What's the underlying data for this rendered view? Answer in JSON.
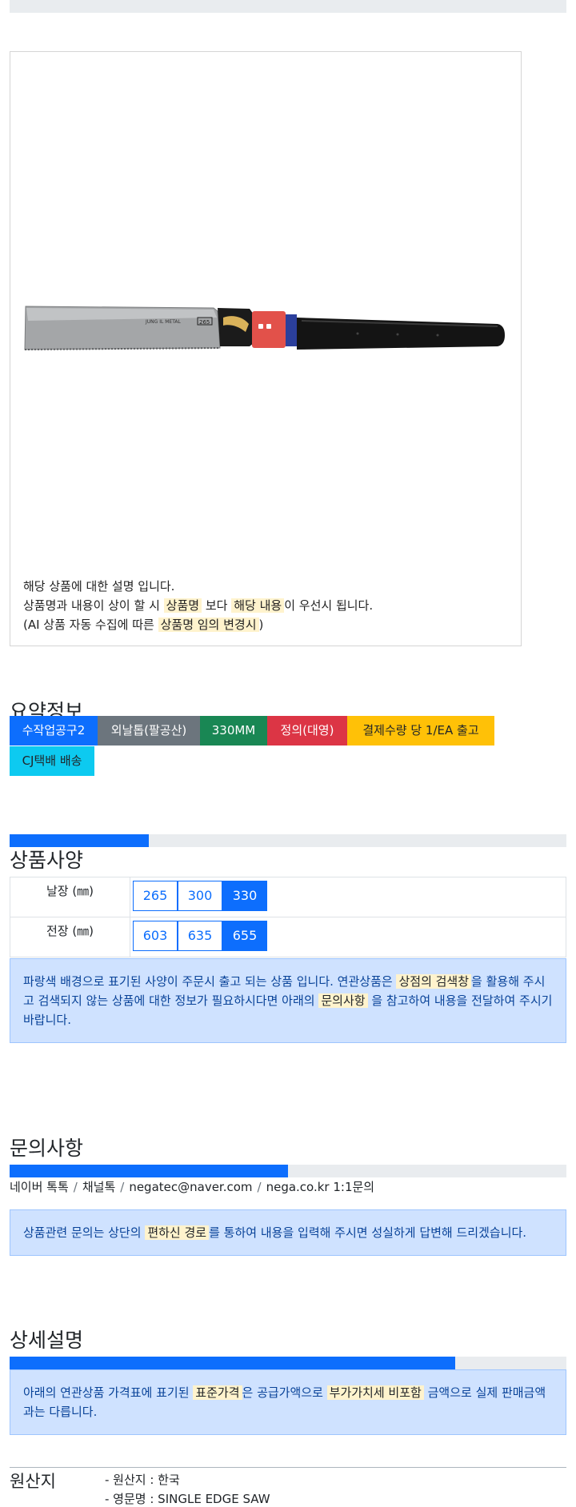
{
  "product": {
    "image_alt": "single edge saw",
    "note_lines": {
      "line1": "해당 상품에 대한 설명 입니다.",
      "line2_a": "상품명과 내용이 상이 할 시",
      "line2_hl1": "상품명",
      "line2_b": "보다",
      "line2_hl2": "해당 내용",
      "line2_c": "이 우선시 됩니다.",
      "line3_a": "(AI 상품 자동 수집에 따른",
      "line3_hl": "상품명 임의 변경시",
      "line3_b": ")"
    }
  },
  "summary": {
    "title": "요약정보",
    "badges": [
      "수작업공구2",
      "외날톱(팔공산)",
      "330MM",
      "정의(대영)",
      "결제수량 당 1/EA 출고",
      "CJ택배 배송"
    ]
  },
  "specs": {
    "title": "상품사양",
    "progress_percent": 25,
    "rows": [
      {
        "label": "날장 (㎜)",
        "options": [
          "265",
          "300",
          "330"
        ],
        "selected": "330"
      },
      {
        "label": "전장 (㎜)",
        "options": [
          "603",
          "635",
          "655"
        ],
        "selected": "655"
      }
    ],
    "notice": {
      "a": "파랑색 배경으로 표기된 사양이 주문시 출고 되는 상품 입니다. 연관상품은",
      "hl1": "상점의 검색창",
      "b": "을 활용해 주시고 검색되지 않는 상품에 대한 정보가 필요하시다면 아래의",
      "hl2": "문의사항",
      "c": "을 참고하여 내용을 전달하여 주시기 바랍니다."
    }
  },
  "inquiry": {
    "title": "문의사항",
    "progress_percent": 50,
    "channels": [
      "네이버 톡톡",
      "채널톡",
      "negatec@naver.com",
      "nega.co.kr 1:1문의"
    ],
    "notice": {
      "a": "상품관련 문의는 상단의",
      "hl": "편하신 경로",
      "b": "를 통하여 내용을 입력해 주시면 성실하게 답변해 드리겠습니다."
    }
  },
  "detail": {
    "title": "상세설명",
    "progress_percent": 80,
    "notice": {
      "a": "아래의 연관상품 가격표에 표기된",
      "hl1": "표준가격",
      "b": "은 공급가액으로",
      "hl2": "부가가치세 비포함",
      "c": "금액으로 실제 판매금액과는 다릅니다."
    }
  },
  "origin": {
    "label": "원산지",
    "lines": [
      "- 원산지 : 한국",
      "- 영문명 : SINGLE EDGE SAW"
    ]
  },
  "colors": {
    "primary": "#0d6efd",
    "secondary": "#6c757d",
    "success": "#198754",
    "danger": "#dc3545",
    "warning": "#ffc107",
    "info": "#0dcaf0",
    "alert_bg": "#cfe2ff",
    "highlight": "#fff3cd"
  }
}
